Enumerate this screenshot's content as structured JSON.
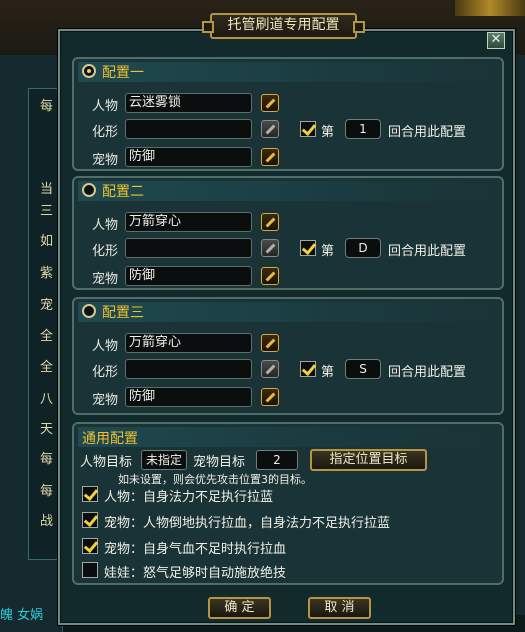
{
  "dialog": {
    "title": "托管刷道专用配置",
    "close_symbol": "✕",
    "confirm_label": "确 定",
    "cancel_label": "取 消"
  },
  "configs": [
    {
      "title": "配置一",
      "selected": true,
      "person_label": "人物",
      "person_value": "云迷雾锁",
      "transform_label": "化形",
      "transform_value": "",
      "pet_label": "宠物",
      "pet_value": "防御",
      "round_enabled": true,
      "round_prefix": "第",
      "round_value": "1",
      "round_suffix": "回合用此配置"
    },
    {
      "title": "配置二",
      "selected": false,
      "person_label": "人物",
      "person_value": "万箭穿心",
      "transform_label": "化形",
      "transform_value": "",
      "pet_label": "宠物",
      "pet_value": "防御",
      "round_enabled": true,
      "round_prefix": "第",
      "round_value": "D",
      "round_suffix": "回合用此配置"
    },
    {
      "title": "配置三",
      "selected": false,
      "person_label": "人物",
      "person_value": "万箭穿心",
      "transform_label": "化形",
      "transform_value": "",
      "pet_label": "宠物",
      "pet_value": "防御",
      "round_enabled": true,
      "round_prefix": "第",
      "round_value": "S",
      "round_suffix": "回合用此配置"
    }
  ],
  "general": {
    "title": "通用配置",
    "person_target_label": "人物目标",
    "person_target_value": "未指定",
    "pet_target_label": "宠物目标",
    "pet_target_value": "2",
    "assign_button": "指定位置目标",
    "hint": "如未设置，则会优先攻击位置3的目标。",
    "options": [
      {
        "label": "人物：自身法力不足执行拉蓝",
        "checked": true
      },
      {
        "label": "宠物：人物倒地执行拉血，自身法力不足执行拉蓝",
        "checked": true
      },
      {
        "label": "宠物：自身气血不足时执行拉血",
        "checked": true
      },
      {
        "label": "娃娃：怒气足够时自动施放绝技",
        "checked": false
      }
    ]
  },
  "background": {
    "left_chars": [
      "每",
      "当",
      "三",
      "如",
      "紫",
      "宠",
      "全",
      "全",
      "八",
      "天",
      "每",
      "每",
      "战"
    ],
    "bottom_text": "魄 女娲"
  },
  "colors": {
    "accent_gold": "#b39544",
    "title_yellow": "#f0c030",
    "check_yellow": "#f0d040",
    "panel_bg": "#1a3336"
  }
}
